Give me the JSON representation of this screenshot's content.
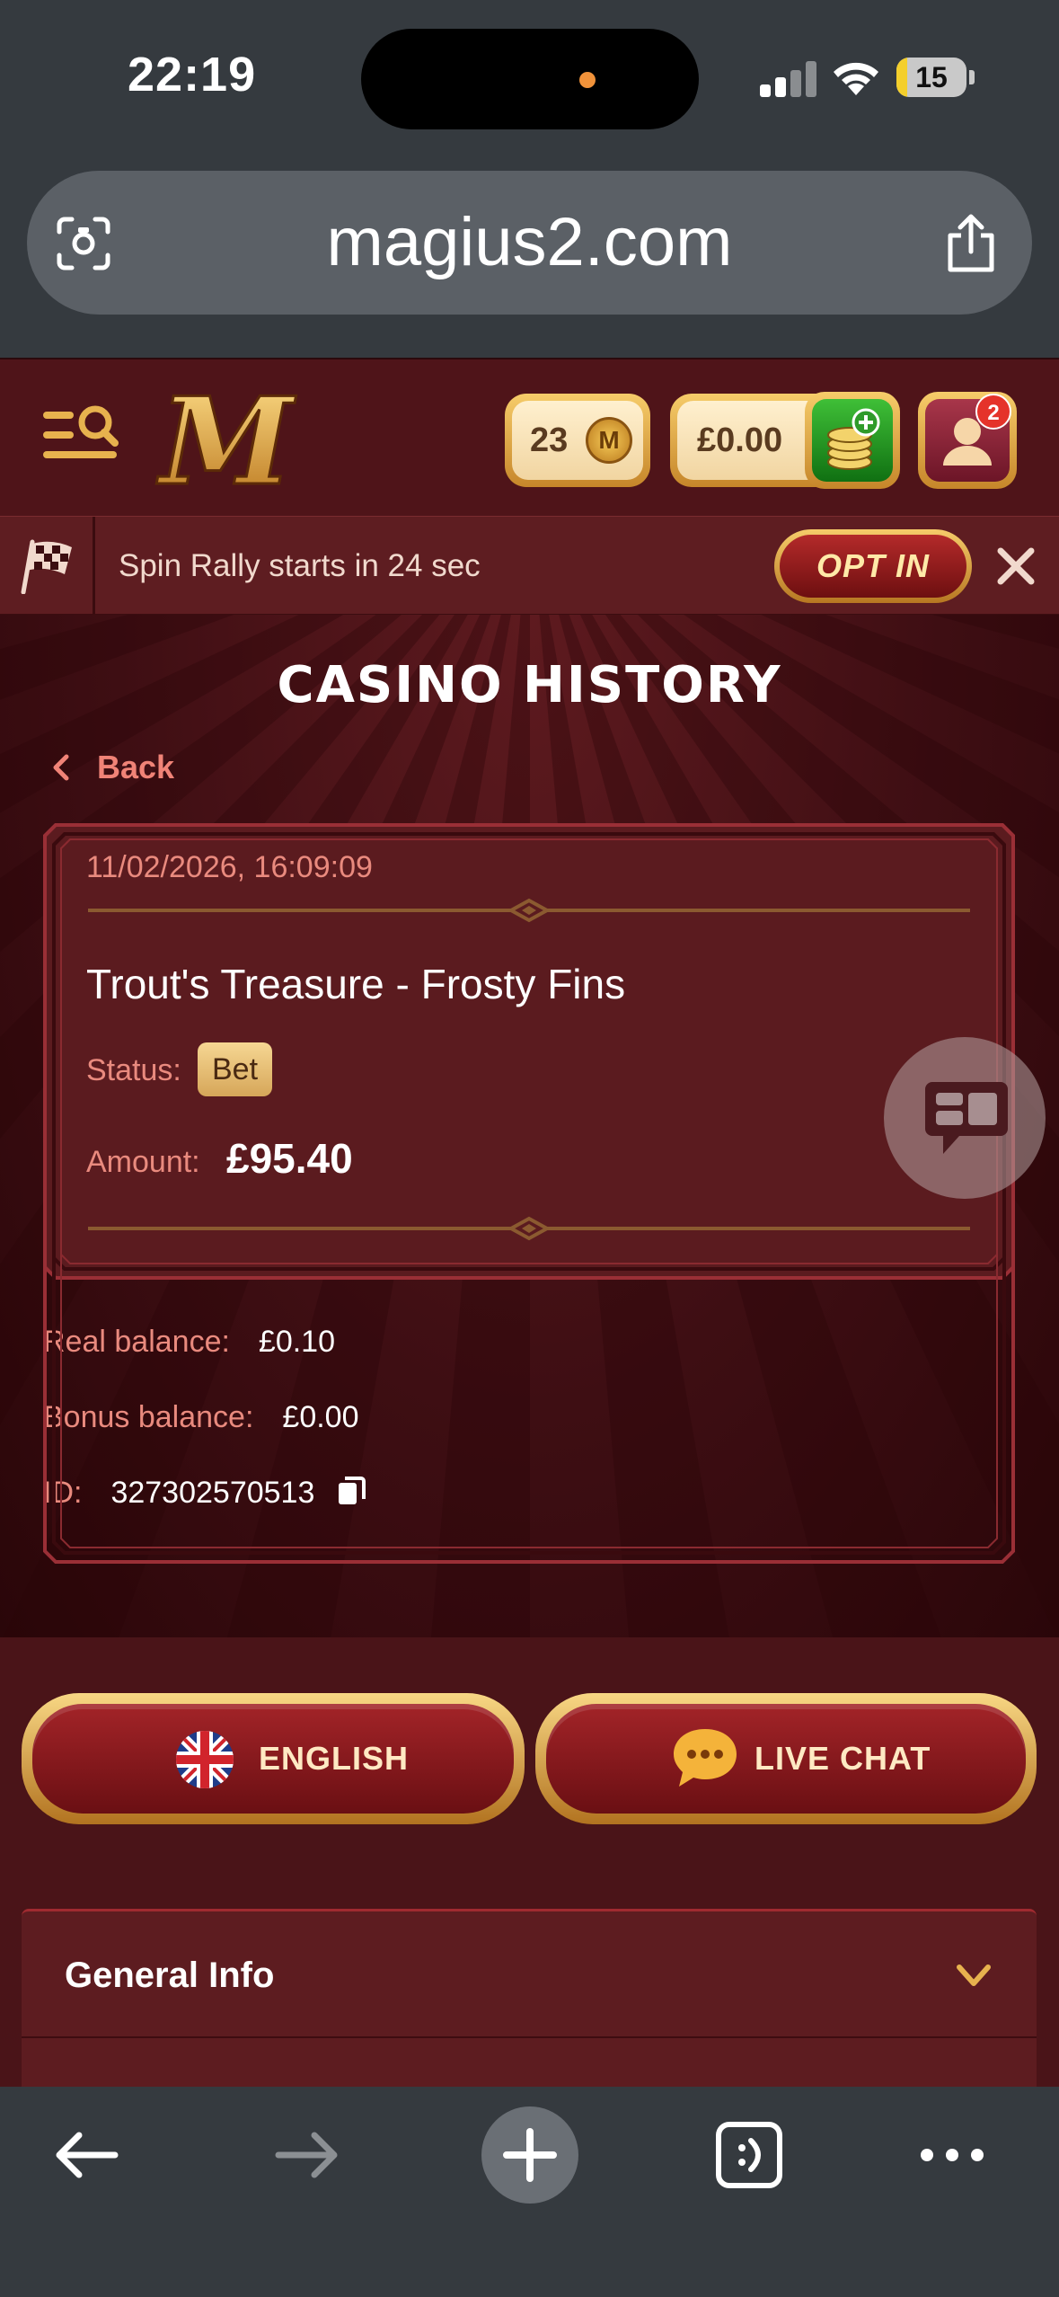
{
  "status_bar": {
    "time": "22:19",
    "battery_percent": "15",
    "battery_level": 0.15
  },
  "browser": {
    "url": "magius2.com"
  },
  "header": {
    "coins": "23",
    "coin_symbol": "M",
    "balance": "£0.00",
    "notification_count": "2"
  },
  "promo": {
    "text": "Spin Rally starts in 24 sec",
    "opt_in_label": "OPT IN"
  },
  "page": {
    "title": "CASINO HISTORY",
    "back_label": "Back"
  },
  "history_item": {
    "datetime": "11/02/2026, 16:09:09",
    "game": "Trout's Treasure - Frosty Fins",
    "status_label": "Status:",
    "status_value": "Bet",
    "amount_label": "Amount:",
    "amount_value": "£95.40",
    "real_balance_label": "Real balance:",
    "real_balance_value": "£0.10",
    "bonus_balance_label": "Bonus balance:",
    "bonus_balance_value": "£0.00",
    "id_label": "ID:",
    "id_value": "327302570513"
  },
  "footer": {
    "language_button": "ENGLISH",
    "live_chat_button": "LIVE CHAT",
    "accordion_general_info": "General Info"
  },
  "icons": {
    "menu": "menu-search-icon",
    "flag": "checkered-flag-icon",
    "close": "close-icon",
    "back": "chevron-left-icon",
    "copy": "copy-icon",
    "chat_fab": "chat-bubbles-icon",
    "deposit": "coins-plus-icon",
    "profile": "user-icon"
  },
  "colors": {
    "brand_dark": "#4f1419",
    "accent_gold": "#d6a659",
    "link_red": "#f08377",
    "label_red": "#e98a7e"
  }
}
